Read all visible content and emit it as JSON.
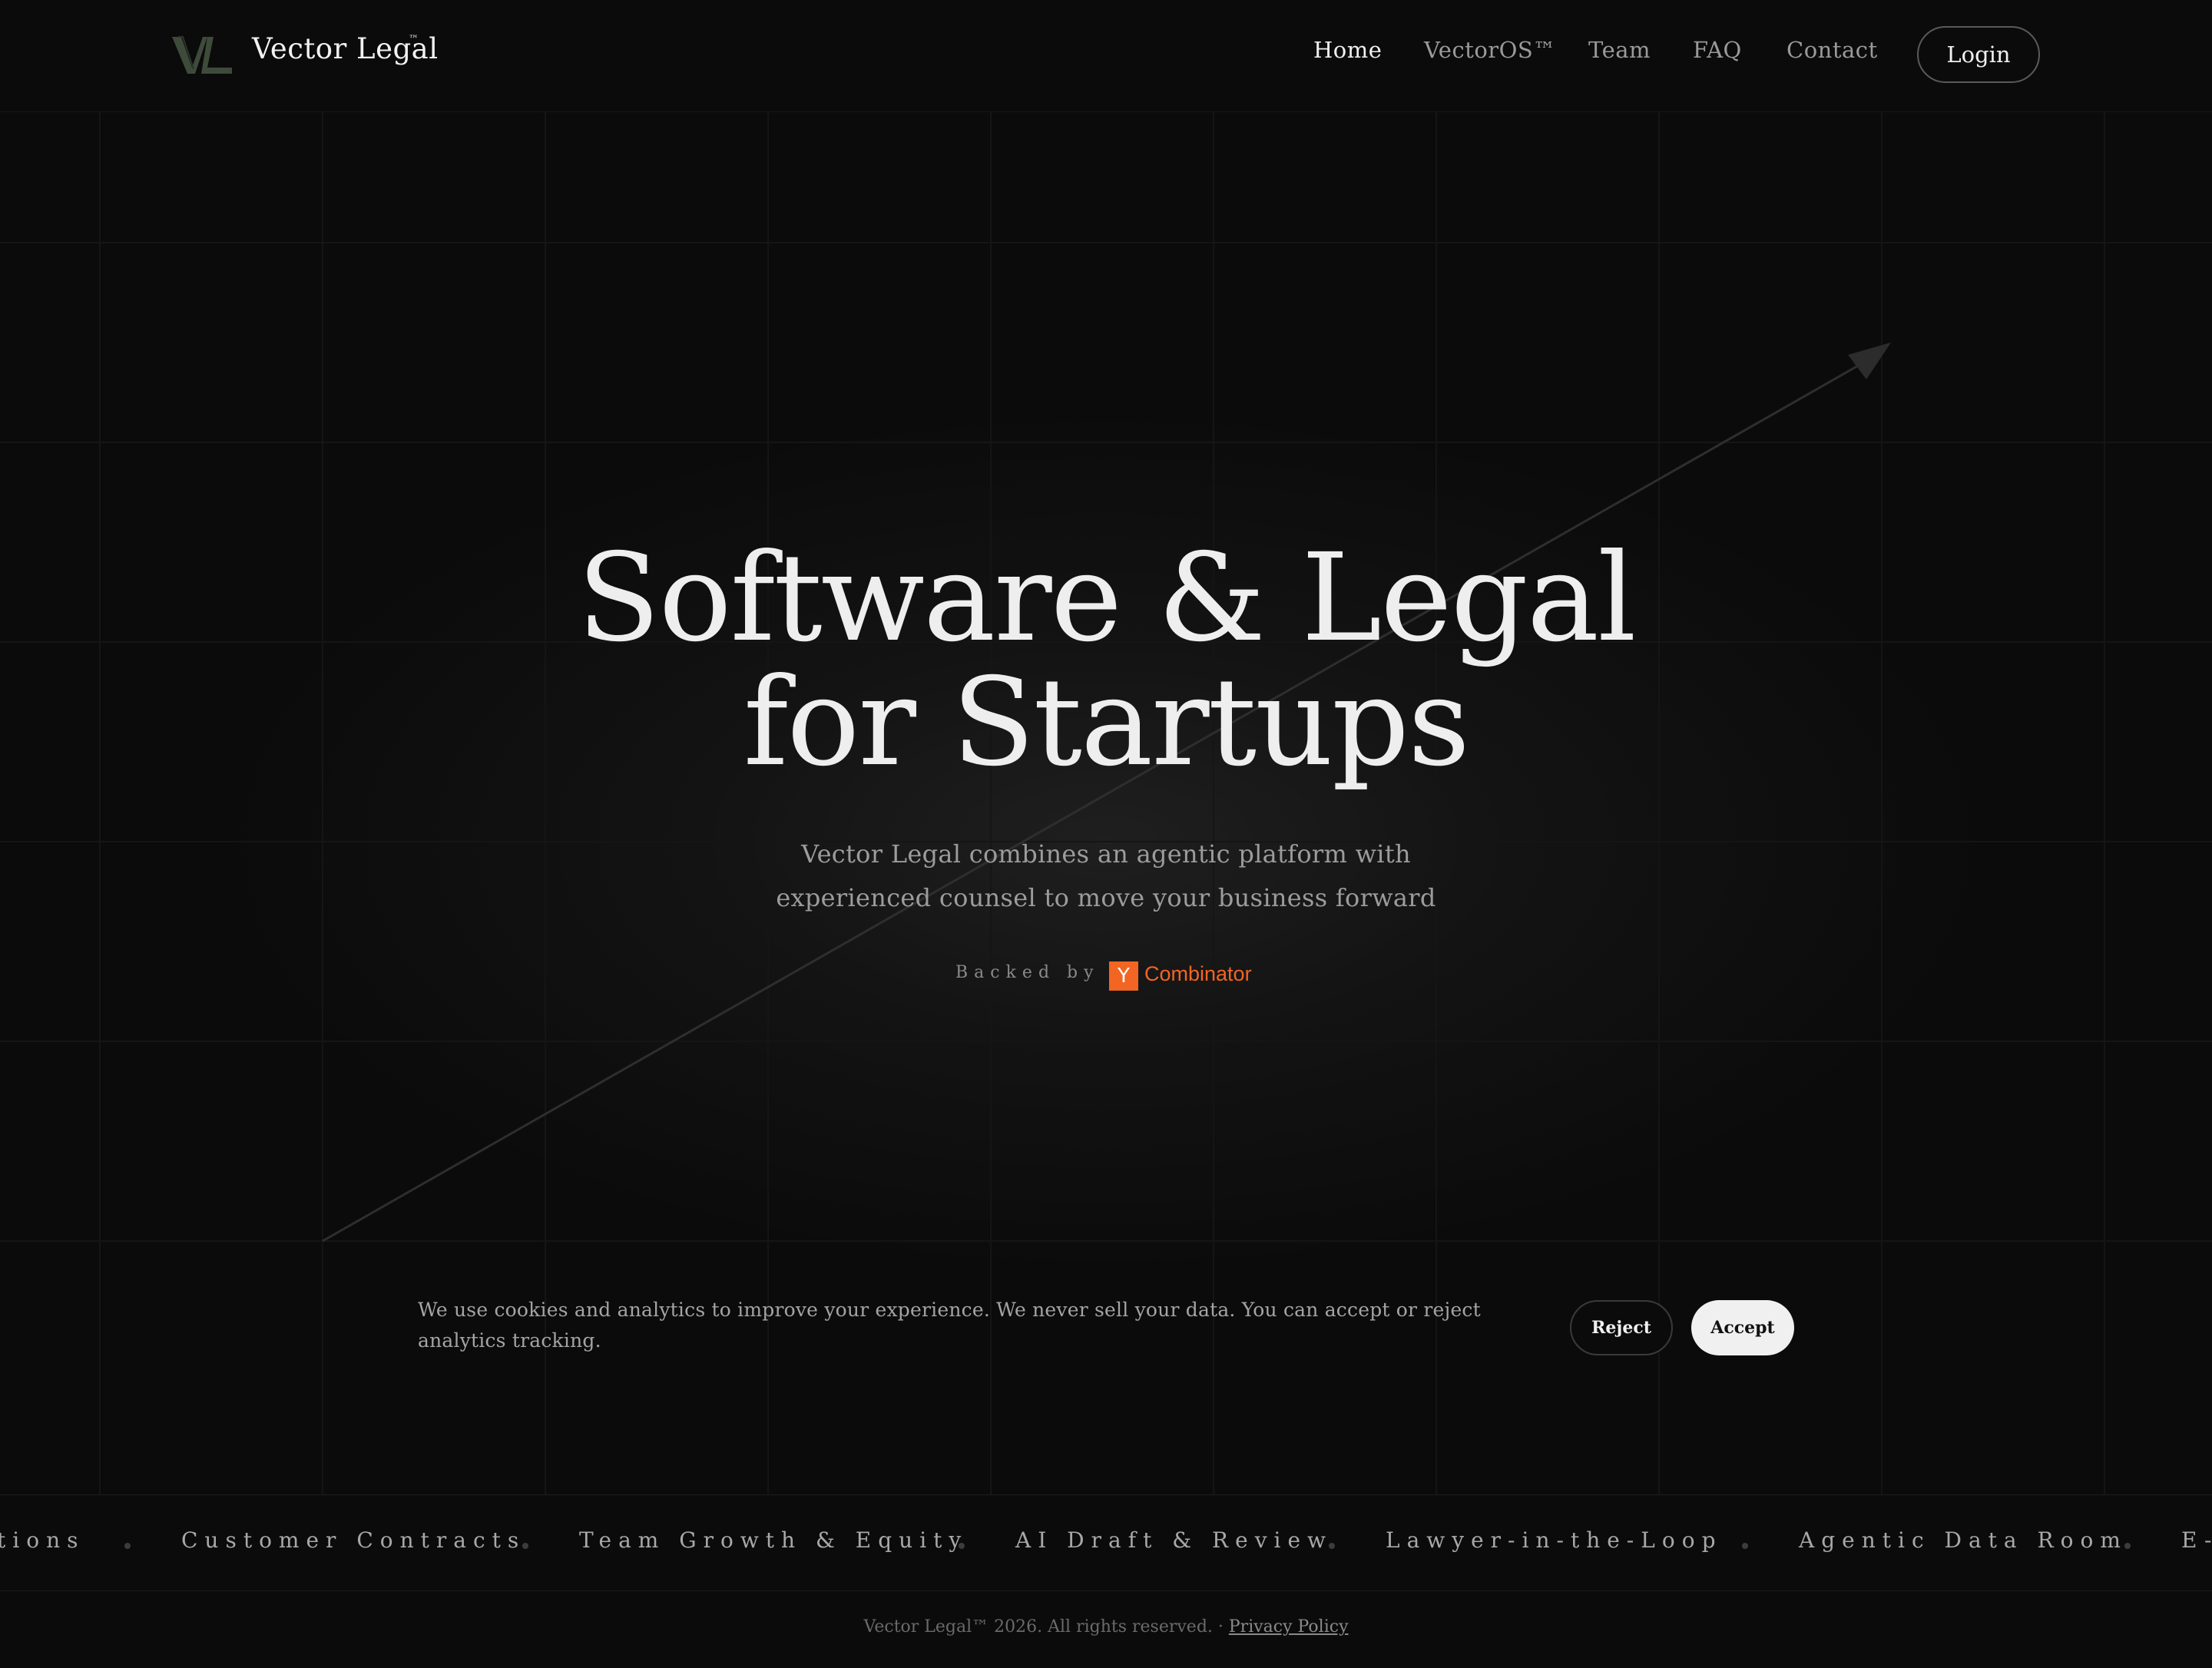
{
  "header": {
    "logo_text": "Vector Legal",
    "logo_tm": "™",
    "nav": {
      "home": "Home",
      "vectoros": "VectorOS™",
      "team": "Team",
      "faq": "FAQ",
      "contact": "Contact"
    },
    "login_label": "Login"
  },
  "hero": {
    "title_line1": "Software & Legal",
    "title_line2": "for Startups",
    "subtitle_line1": "Vector Legal combines an agentic platform with",
    "subtitle_line2": "experienced counsel to move your business forward",
    "backed_by": "Backed by",
    "yc_letter": "Y",
    "yc_name": "Combinator"
  },
  "cookie": {
    "message": "We use cookies and analytics to improve your experience. We never sell your data. You can accept or reject analytics tracking.",
    "reject_label": "Reject",
    "accept_label": "Accept"
  },
  "ticker": {
    "items": [
      "tions",
      "Customer Contracts",
      "Team Growth & Equity",
      "AI Draft & Review",
      "Lawyer-in-the-Loop",
      "Agentic Data Room",
      "E-"
    ]
  },
  "footer": {
    "copyright": "Vector Legal™ 2026. All rights reserved. · ",
    "privacy_label": "Privacy Policy"
  },
  "colors": {
    "background": "#0b0b0b",
    "accent_yc": "#f26522",
    "logo_green": "#3e4a3a",
    "text_primary": "#eeeeee",
    "text_muted": "#9c9c9c"
  }
}
